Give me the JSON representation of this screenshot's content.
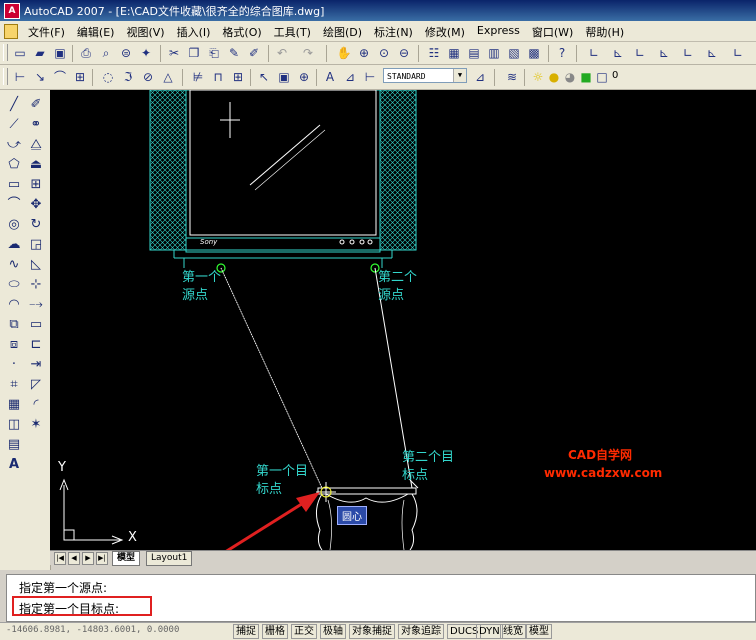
{
  "window": {
    "title": "AutoCAD 2007 - [E:\\CAD文件收藏\\很齐全的综合图库.dwg]",
    "app_icon": "A"
  },
  "menu": [
    "文件(F)",
    "编辑(E)",
    "视图(V)",
    "插入(I)",
    "格式(O)",
    "工具(T)",
    "绘图(D)",
    "标注(N)",
    "修改(M)",
    "Express",
    "窗口(W)",
    "帮助(H)"
  ],
  "toolbar": {
    "text_style": "STANDARD",
    "layer_name": "0"
  },
  "canvas": {
    "labels": {
      "src1_a": "第一个",
      "src1_b": "源点",
      "src2_a": "第二个",
      "src2_b": "源点",
      "dst1_a": "第一个目",
      "dst1_b": "标点",
      "dst2_a": "第二个目",
      "dst2_b": "标点",
      "ucs_y": "Y",
      "ucs_x": "X"
    },
    "snap_tooltip": "圆心",
    "tv_brand": "Sony",
    "watermark_line1": "CAD自学网",
    "watermark_line2": "www.cadzxw.com",
    "colors": {
      "background": "#000000",
      "geometry": "#33d6cc",
      "lines": "#ffffff",
      "marker": "#33ff33",
      "watermark": "#ff2a00",
      "annotation_arrow": "#e02020"
    }
  },
  "layout_tabs": {
    "model": "模型",
    "layout1": "Layout1"
  },
  "command": {
    "line1": "指定第一个源点:",
    "line2": "指定第一个目标点:"
  },
  "status": {
    "coords": "-14606.8981, -14803.6001, 0.0000",
    "buttons": [
      "捕捉",
      "栅格",
      "正交",
      "极轴",
      "对象捕捉",
      "对象追踪",
      "DUCS",
      "DYN",
      "线宽",
      "模型"
    ]
  }
}
